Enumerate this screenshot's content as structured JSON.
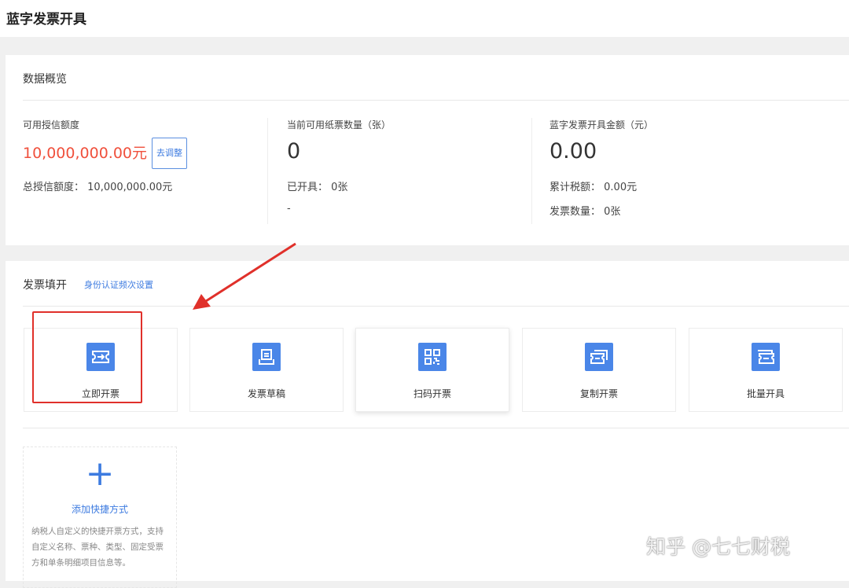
{
  "page_title": "蓝字发票开具",
  "overview": {
    "title": "数据概览",
    "credit": {
      "label": "可用授信额度",
      "value": "10,000,000.00元",
      "adjust_button": "去调整",
      "total_label": "总授信额度：",
      "total_value": "10,000,000.00元"
    },
    "paper": {
      "label": "当前可用纸票数量（张）",
      "value": "0",
      "issued_label": "已开具：",
      "issued_value": "0张",
      "extra": "-"
    },
    "amount": {
      "label": "蓝字发票开具金额（元）",
      "value": "0.00",
      "tax_label": "累计税额：",
      "tax_value": "0.00元",
      "count_label": "发票数量：",
      "count_value": "0张"
    }
  },
  "issue": {
    "title": "发票填开",
    "settings_link": "身份认证频次设置",
    "tiles": [
      {
        "label": "立即开票",
        "icon": "ticket-arrow-icon"
      },
      {
        "label": "发票草稿",
        "icon": "draft-icon"
      },
      {
        "label": "扫码开票",
        "icon": "qr-code-icon"
      },
      {
        "label": "复制开票",
        "icon": "copy-ticket-icon"
      },
      {
        "label": "批量开具",
        "icon": "batch-ticket-icon"
      }
    ],
    "add_shortcut": {
      "label": "添加快捷方式",
      "description": "纳税人自定义的快捷开票方式，支持自定义名称、票种、类型、固定受票方和单条明细项目信息等。"
    }
  },
  "watermark": "知乎 @七七财税",
  "colors": {
    "accent": "#4a86e8",
    "highlight": "#f0503c",
    "annotation": "#e0302a"
  }
}
